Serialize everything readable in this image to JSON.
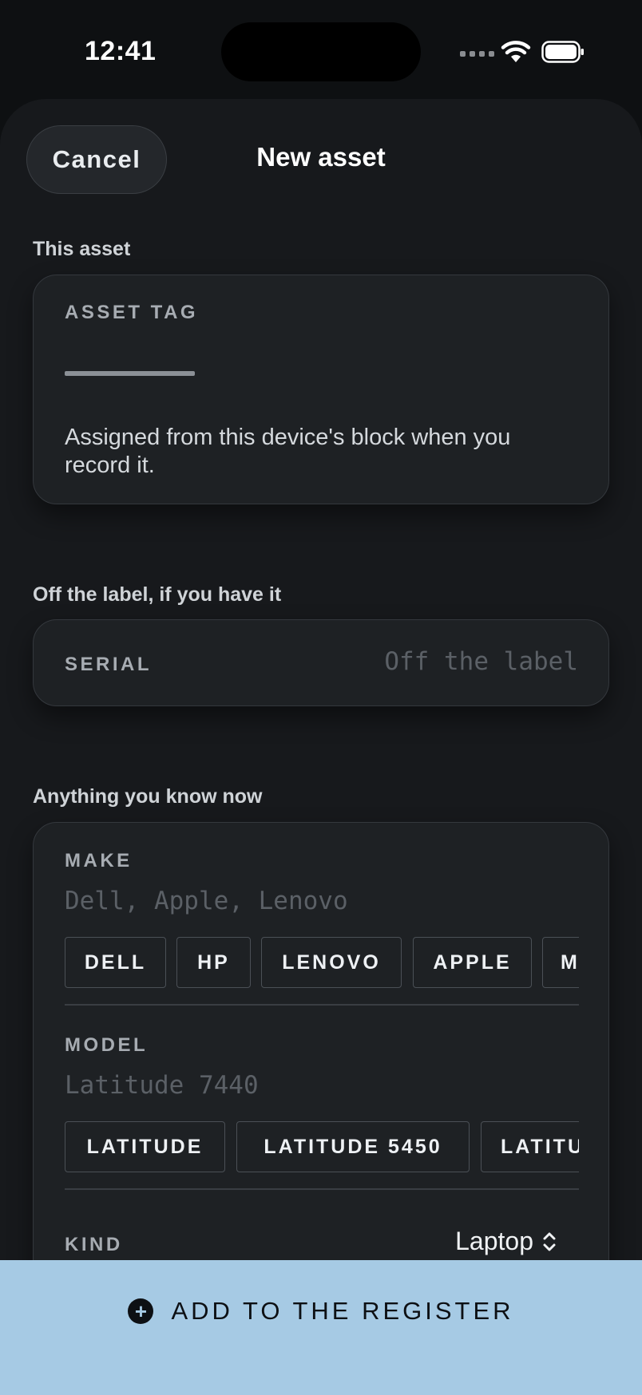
{
  "status_bar": {
    "time": "12:41"
  },
  "header": {
    "cancel_label": "Cancel",
    "title": "New asset"
  },
  "asset_section": {
    "label": "This asset",
    "asset_tag_label": "ASSET TAG",
    "help_text": "Assigned from this device's block when you record it."
  },
  "serial_section": {
    "label": "Off the label, if you have it",
    "serial_label": "SERIAL",
    "serial_placeholder": "Off the label"
  },
  "details_section": {
    "label": "Anything you know now",
    "make_label": "MAKE",
    "make_placeholder": "Dell, Apple, Lenovo",
    "make_chips": [
      "DELL",
      "HP",
      "LENOVO",
      "APPLE",
      "M"
    ],
    "model_label": "MODEL",
    "model_placeholder": "Latitude 7440",
    "model_chips": [
      "LATITUDE",
      "LATITUDE 5450",
      "LATITU"
    ],
    "kind_label": "KIND",
    "kind_value": "Laptop"
  },
  "cta": {
    "label": "ADD TO THE REGISTER"
  },
  "colors": {
    "accent": "#a6cae4",
    "background": "#0e1012",
    "card": "#1e2124"
  }
}
